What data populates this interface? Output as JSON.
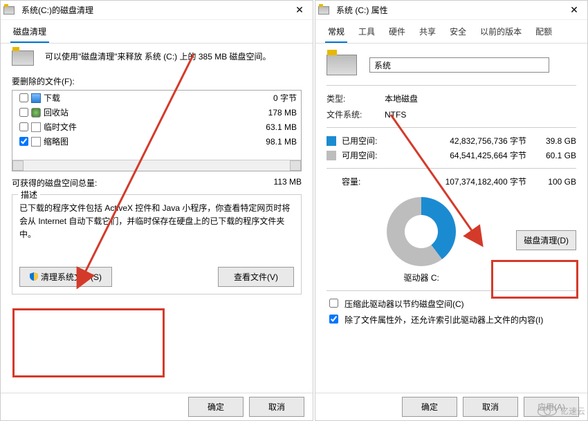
{
  "leftWindow": {
    "title": "系统(C:)的磁盘清理",
    "tab": "磁盘清理",
    "introText": "可以使用\"磁盘清理\"来释放 系统 (C:) 上的 385 MB 磁盘空间。",
    "filesToDeleteLabel": "要删除的文件(F):",
    "files": [
      {
        "name": "下载",
        "size": "0 字节",
        "checked": false,
        "icon": "dl"
      },
      {
        "name": "回收站",
        "size": "178 MB",
        "checked": false,
        "icon": "bin"
      },
      {
        "name": "临时文件",
        "size": "63.1 MB",
        "checked": false,
        "icon": "doc"
      },
      {
        "name": "缩略图",
        "size": "98.1 MB",
        "checked": true,
        "icon": "doc"
      }
    ],
    "totalLabel": "可获得的磁盘空间总量:",
    "totalValue": "113 MB",
    "descGroupTitle": "描述",
    "descText": "已下载的程序文件包括 ActiveX 控件和 Java 小程序，你查看特定网页时将会从 Internet 自动下载它们，并临时保存在硬盘上的已下载的程序文件夹中。",
    "cleanSystemBtn": "清理系统文件(S)",
    "viewFilesBtn": "查看文件(V)",
    "okBtn": "确定",
    "cancelBtn": "取消"
  },
  "rightWindow": {
    "title": "系统 (C:) 属性",
    "tabs": [
      "常规",
      "工具",
      "硬件",
      "共享",
      "安全",
      "以前的版本",
      "配额"
    ],
    "activeTab": 0,
    "volumeName": "系统",
    "typeLabel": "类型:",
    "typeValue": "本地磁盘",
    "fsLabel": "文件系统:",
    "fsValue": "NTFS",
    "usedLabel": "已用空间:",
    "usedBytes": "42,832,756,736 字节",
    "usedGB": "39.8 GB",
    "freeLabel": "可用空间:",
    "freeBytes": "64,541,425,664 字节",
    "freeGB": "60.1 GB",
    "capLabel": "容量:",
    "capBytes": "107,374,182,400 字节",
    "capGB": "100 GB",
    "driveLabel": "驱动器 C:",
    "diskCleanupBtn": "磁盘清理(D)",
    "compressLabel": "压缩此驱动器以节约磁盘空间(C)",
    "indexLabel": "除了文件属性外，还允许索引此驱动器上文件的内容(I)",
    "compressChecked": false,
    "indexChecked": true,
    "okBtn": "确定",
    "cancelBtn": "取消",
    "applyBtn": "应用(A)"
  },
  "watermark": "亿速云"
}
